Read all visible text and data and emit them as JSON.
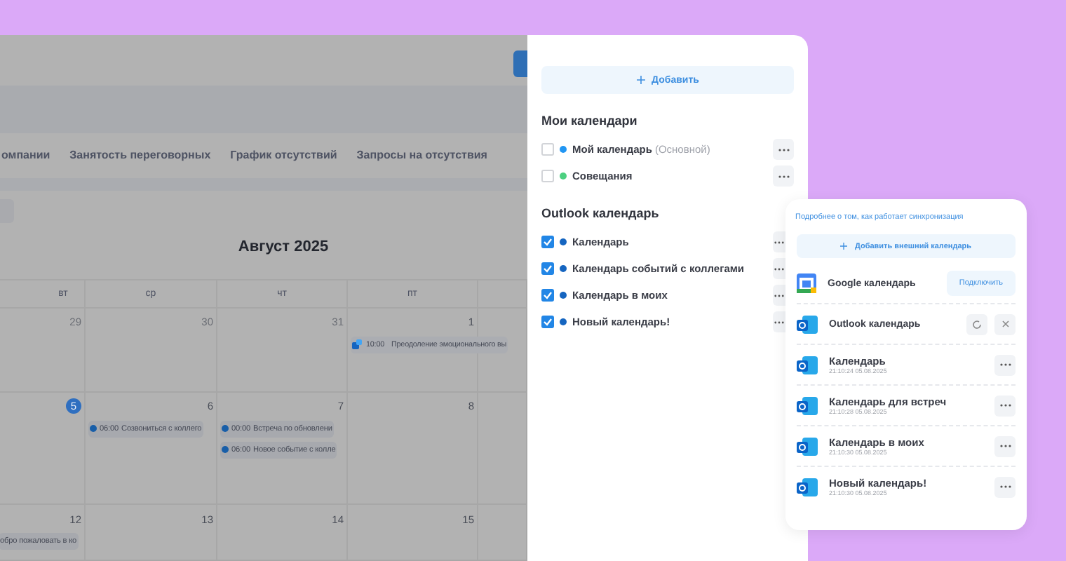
{
  "calendar": {
    "tabs": [
      {
        "label": "омпании"
      },
      {
        "label": "Занятость переговорных"
      },
      {
        "label": "График отсутствий"
      },
      {
        "label": "Запросы на отсутствия"
      }
    ],
    "title": "Август 2025",
    "weekdays": [
      "вт",
      "ср",
      "чт",
      "пт"
    ],
    "weeks": [
      {
        "days": [
          {
            "date": "29",
            "muted": true,
            "today": false
          },
          {
            "date": "30",
            "muted": true,
            "today": false
          },
          {
            "date": "31",
            "muted": true,
            "today": false
          },
          {
            "date": "1",
            "muted": false,
            "today": false,
            "events": [
              {
                "kind": "icon",
                "time": "10:00",
                "title": "Преодоление эмоционального вы"
              }
            ]
          }
        ]
      },
      {
        "days": [
          {
            "date": "5",
            "muted": false,
            "today": true
          },
          {
            "date": "6",
            "muted": false,
            "today": false,
            "events": [
              {
                "kind": "dot",
                "time": "06:00",
                "title": "Созвониться с коллего"
              }
            ]
          },
          {
            "date": "7",
            "muted": false,
            "today": false,
            "events": [
              {
                "kind": "dot",
                "time": "00:00",
                "title": "Встреча по обновлени"
              },
              {
                "kind": "dot",
                "time": "06:00",
                "title": "Новое событие с колле"
              }
            ]
          },
          {
            "date": "8",
            "muted": false,
            "today": false
          }
        ]
      },
      {
        "days": [
          {
            "date": "12",
            "muted": false,
            "today": false,
            "events": [
              {
                "kind": "text",
                "title": "обро пожаловать в ко"
              }
            ]
          },
          {
            "date": "13",
            "muted": false,
            "today": false
          },
          {
            "date": "14",
            "muted": false,
            "today": false
          },
          {
            "date": "15",
            "muted": false,
            "today": false
          }
        ]
      }
    ]
  },
  "panel": {
    "add_button": "Добавить",
    "sections": [
      {
        "title": "Мои календари",
        "items": [
          {
            "name": "Мой календарь",
            "note": "(Основной)",
            "checked": false,
            "color": "#2196f3"
          },
          {
            "name": "Совещания",
            "checked": false,
            "color": "#4cd080"
          }
        ]
      },
      {
        "title": "Outlook календарь",
        "items": [
          {
            "name": "Календарь",
            "checked": true,
            "color": "#1565c0"
          },
          {
            "name": "Календарь событий с коллегами",
            "checked": true,
            "color": "#1565c0"
          },
          {
            "name": "Календарь в моих",
            "checked": true,
            "color": "#1565c0"
          },
          {
            "name": "Новый календарь!",
            "checked": true,
            "color": "#1565c0"
          }
        ]
      }
    ]
  },
  "sync_card": {
    "link": "Подробнее о том, как работает синхронизация",
    "add_button": "Добавить внешний календарь",
    "providers": [
      {
        "kind": "google",
        "name": "Google календарь",
        "connected": false,
        "action": "Подключить"
      },
      {
        "kind": "outlook",
        "name": "Outlook календарь",
        "connected": true
      }
    ],
    "calendars": [
      {
        "name": "Календарь",
        "timestamp": "21:10:24 05.08.2025"
      },
      {
        "name": "Календарь для встреч",
        "timestamp": "21:10:28 05.08.2025"
      },
      {
        "name": "Календарь в моих",
        "timestamp": "21:10:30 05.08.2025"
      },
      {
        "name": "Новый календарь!",
        "timestamp": "21:10:30 05.08.2025"
      }
    ]
  }
}
